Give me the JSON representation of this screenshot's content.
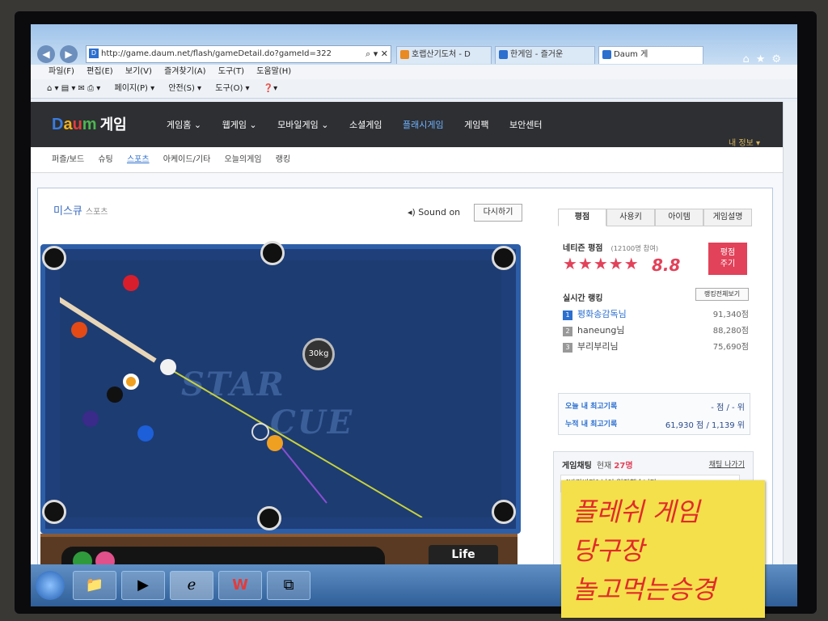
{
  "browser": {
    "url": "http://game.daum.net/flash/gameDetail.do?gameId=322",
    "tabs": [
      "호랩산기도처 - D",
      "한게임 - 즐거운",
      "Daum 게"
    ],
    "menu": [
      "파일(F)",
      "편집(E)",
      "보기(V)",
      "즐겨찾기(A)",
      "도구(T)",
      "도움말(H)"
    ],
    "commands": [
      "페이지(P) ▾",
      "안전(S) ▾",
      "도구(O) ▾"
    ]
  },
  "header": {
    "logo_letters": [
      "D",
      "a",
      "u",
      "m"
    ],
    "logo_suffix": "게임",
    "nav": [
      "게임홈 ⌄",
      "웹게임 ⌄",
      "모바일게임 ⌄",
      "소셜게임",
      "플래시게임",
      "게임팩",
      "보안센터"
    ],
    "active_nav_index": 4,
    "my_info": "내 정보 ▾"
  },
  "subnav": {
    "items": [
      "퍼즐/보드",
      "슈팅",
      "스포츠",
      "아케이드/기타",
      "오늘의게임",
      "랭킹"
    ],
    "active_index": 2
  },
  "game": {
    "title": "미스큐",
    "category": "스포츠",
    "sound": "◂) Sound on",
    "restart": "다시하기",
    "table_logo_1": "STAR",
    "table_logo_2": "CUE",
    "power": "30kg",
    "life": "Life"
  },
  "panel": {
    "tabs": [
      "평점",
      "사용키",
      "아이템",
      "게임설명"
    ],
    "rating_title": "네티즌 평점",
    "rating_participants": "(12100명 참여)",
    "stars": "★★★★★",
    "rating_value": "8.8",
    "rating_fraction": 0.88,
    "rate_button_1": "평점",
    "rate_button_2": "주기",
    "ranking_title": "실시간 랭킹",
    "ranking_all": "랭킹전체보기",
    "rankings": [
      {
        "rank": "1",
        "name": "평화송감독님",
        "points": "91,340점"
      },
      {
        "rank": "2",
        "name": "haneung님",
        "points": "88,280점"
      },
      {
        "rank": "3",
        "name": "부리부리님",
        "points": "75,690점"
      }
    ],
    "today_best_label": "오늘 내 최고기록",
    "today_best_value": "- 점 / - 위",
    "total_best_label": "누적 내 최고기록",
    "total_best_value": "61,930 점 / 1,139 위",
    "chat_title": "게임채팅",
    "chat_count_label": "현재",
    "chat_count": "27명",
    "chat_exit": "채팅 나가기",
    "chat_message": "[바란바다] 님이 입장했습니다."
  },
  "sticky_note": {
    "line1": "플레쉬 게임",
    "line2": "당구장",
    "line3": "놀고먹는승경"
  },
  "colors": {
    "daum_header": "#2d2f33",
    "felt": "#1d3c72",
    "accent_red": "#e2425a",
    "link_blue": "#2b6fcf",
    "sticky": "#f4e04a"
  }
}
